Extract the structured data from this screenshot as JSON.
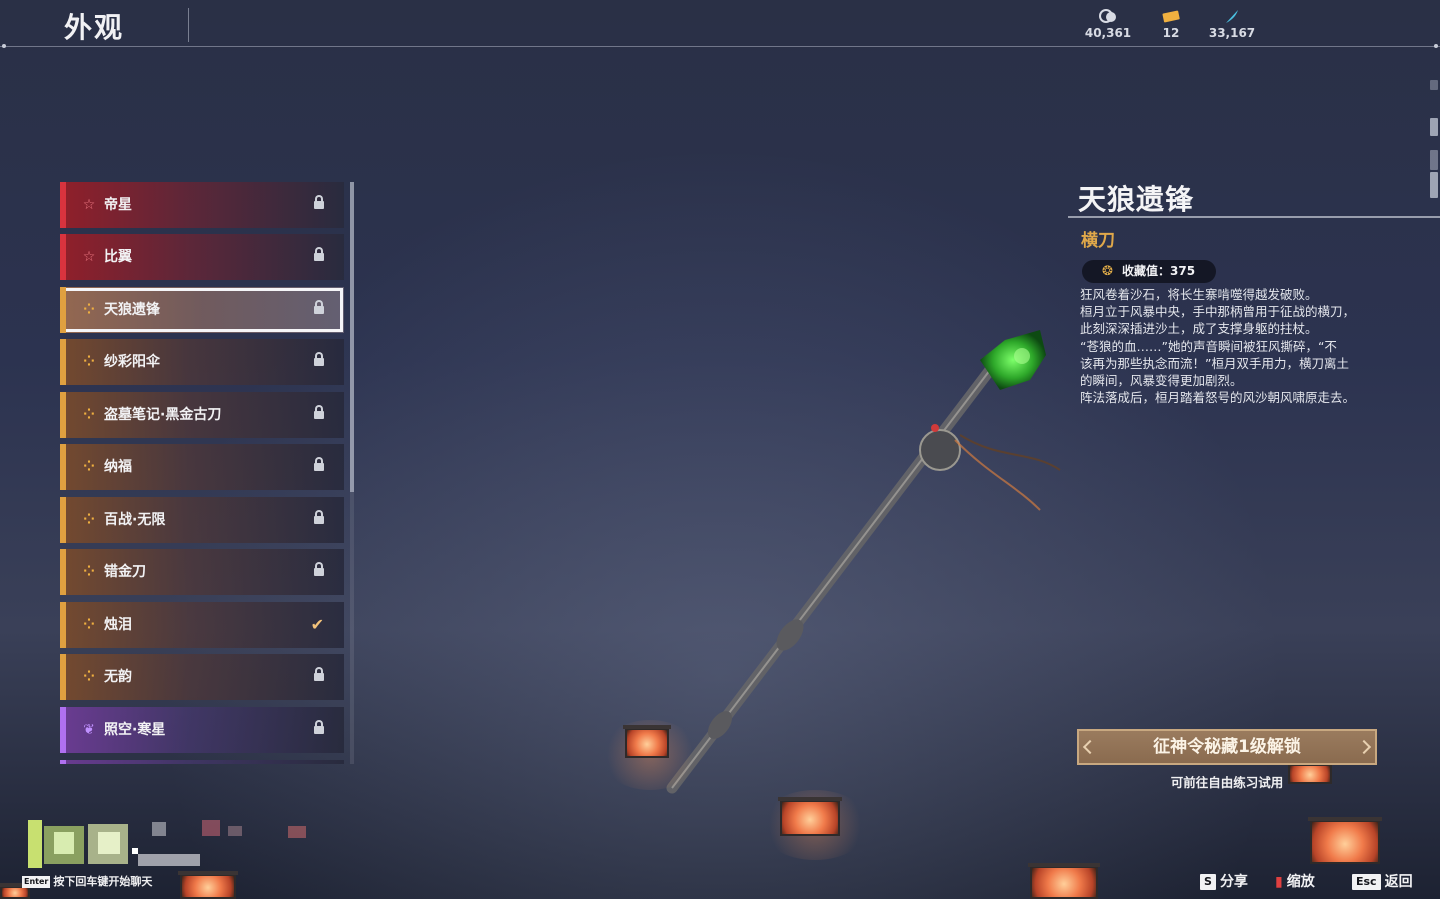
{
  "header": {
    "title": "外观",
    "currencies": [
      {
        "icon": "silver-coins-icon",
        "value": "40,361"
      },
      {
        "icon": "ticket-icon",
        "value": "12"
      },
      {
        "icon": "feather-icon",
        "value": "33,167"
      }
    ]
  },
  "skins": [
    {
      "name": "帝星",
      "rarity": "red",
      "state": "locked"
    },
    {
      "name": "比翼",
      "rarity": "red",
      "state": "locked"
    },
    {
      "name": "天狼遗锋",
      "rarity": "gold",
      "state": "locked",
      "selected": true
    },
    {
      "name": "纱彩阳伞",
      "rarity": "gold",
      "state": "locked"
    },
    {
      "name": "盗墓笔记·黑金古刀",
      "rarity": "gold",
      "state": "locked"
    },
    {
      "name": "纳福",
      "rarity": "gold",
      "state": "locked"
    },
    {
      "name": "百战·无限",
      "rarity": "gold",
      "state": "locked"
    },
    {
      "name": "错金刀",
      "rarity": "gold",
      "state": "locked"
    },
    {
      "name": "烛泪",
      "rarity": "gold",
      "state": "owned"
    },
    {
      "name": "无韵",
      "rarity": "gold",
      "state": "locked"
    },
    {
      "name": "照空·寒星",
      "rarity": "purple",
      "state": "locked"
    }
  ],
  "detail": {
    "name": "天狼遗锋",
    "type": "横刀",
    "collect_label": "收藏值：375",
    "description": [
      "狂风卷着沙石，将长生寨啃噬得越发破败。",
      "桓月立于风暴中央，手中那柄曾用于征战的横刀，",
      "此刻深深插进沙土，成了支撑身躯的拄杖。",
      "“苍狼的血……”她的声音瞬间被狂风撕碎，“不",
      "该再为那些执念而流！”桓月双手用力，横刀离土",
      "的瞬间，风暴变得更加剧烈。",
      "阵法落成后，桓月踏着怒号的风沙朝风啸原走去。"
    ],
    "unlock_button": "征神令秘藏1级解锁",
    "trial_text": "可前往自由练习试用"
  },
  "footer": {
    "chat_key": "Enter",
    "chat_hint": "按下回车键开始聊天",
    "actions": [
      {
        "key": "S",
        "label": "分享"
      },
      {
        "key": "🕮",
        "label": "缩放"
      },
      {
        "key": "Esc",
        "label": "返回"
      }
    ]
  },
  "colors": {
    "red_rarity": "#d8333e",
    "gold_rarity": "#e0a040",
    "purple_rarity": "#b070f0",
    "type_text": "#e0a84a",
    "unlock_button": "#8a6b4f"
  }
}
